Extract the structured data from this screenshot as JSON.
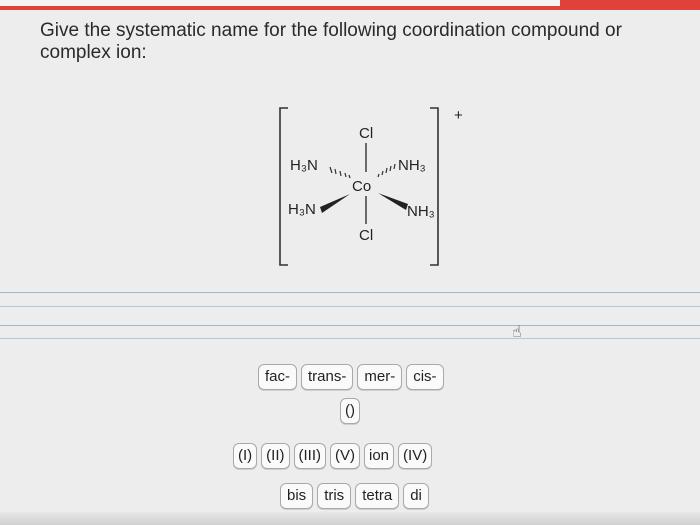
{
  "question": "Give the systematic name for the following coordination compound or complex ion:",
  "structure": {
    "metal": "Co",
    "charge": "+",
    "ligands": {
      "top": "Cl",
      "bottom": "Cl",
      "upper_left": "H₃N",
      "lower_left": "H₃N",
      "upper_right": "NH₃",
      "lower_right": "NH₃"
    }
  },
  "tiles": {
    "prefixes": [
      "fac-",
      "trans-",
      "mer-",
      "cis-"
    ],
    "parens": "()",
    "numerals": [
      "(I)",
      "(II)",
      "(III)",
      "(V)",
      "ion",
      "(IV)"
    ],
    "multipliers": [
      "bis",
      "tris",
      "tetra",
      "di"
    ]
  }
}
